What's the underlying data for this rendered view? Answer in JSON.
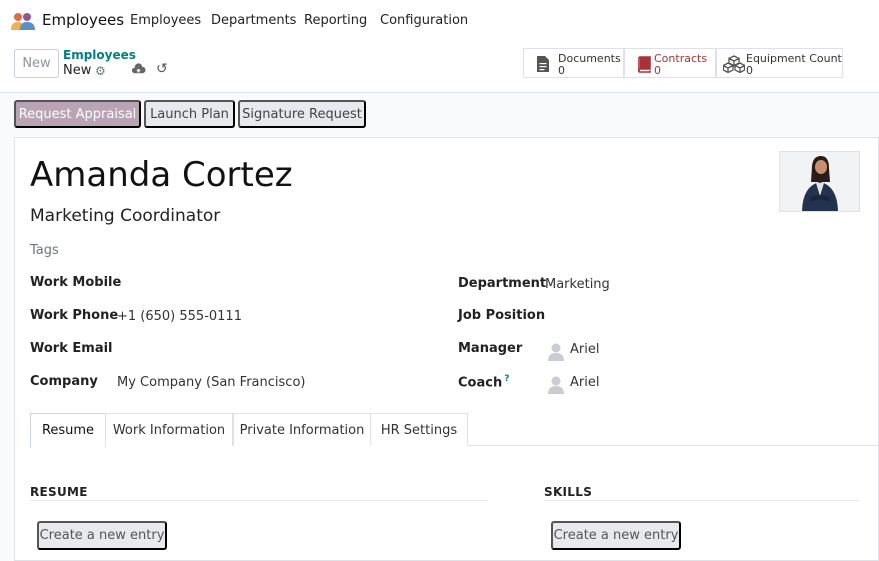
{
  "navbar": {
    "app_name": "Employees",
    "menu": [
      "Employees",
      "Departments",
      "Reporting",
      "Configuration"
    ]
  },
  "control_panel": {
    "new_label": "New",
    "breadcrumb_parent": "Employees",
    "breadcrumb_current": "New",
    "stats": [
      {
        "label": "Documents",
        "value": "0",
        "icon": "document-icon"
      },
      {
        "label": "Contracts",
        "value": "0",
        "icon": "book-icon",
        "color": "#a93238"
      },
      {
        "label": "Equipment Count",
        "value": "0",
        "icon": "cubes-icon"
      }
    ]
  },
  "actions": {
    "request_appraisal": "Request Appraisal",
    "launch_plan": "Launch Plan",
    "signature_request": "Signature Request"
  },
  "employee": {
    "name": "Amanda Cortez",
    "job_title": "Marketing Coordinator",
    "tags_placeholder": "Tags"
  },
  "fields": {
    "work_mobile": {
      "label": "Work Mobile",
      "value": ""
    },
    "work_phone": {
      "label": "Work Phone",
      "value": "+1 (650) 555-0111"
    },
    "work_email": {
      "label": "Work Email",
      "value": ""
    },
    "company": {
      "label": "Company",
      "value": "My Company (San Francisco)"
    },
    "department": {
      "label": "Department",
      "value": "Marketing"
    },
    "job_position": {
      "label": "Job Position",
      "value": ""
    },
    "manager": {
      "label": "Manager",
      "value": "Ariel"
    },
    "coach": {
      "label": "Coach",
      "value": "Ariel",
      "help": "?"
    }
  },
  "tabs": [
    "Resume",
    "Work Information",
    "Private Information",
    "HR Settings"
  ],
  "resume": {
    "title": "RESUME",
    "create_label": "Create a new entry"
  },
  "skills": {
    "title": "SKILLS",
    "create_label": "Create a new entry"
  },
  "colors": {
    "primary": "#b9a3b5",
    "accent_teal": "#017e84",
    "contracts_red": "#a93238"
  }
}
